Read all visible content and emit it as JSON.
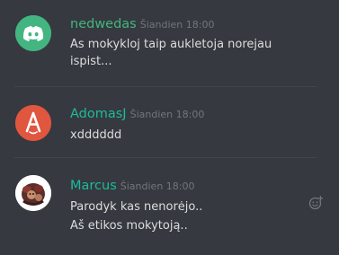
{
  "messages": [
    {
      "username": "nedwedas",
      "username_color": "#43b581",
      "timestamp": "Šiandien 18:00",
      "lines": [
        "As mokykloj taip aukletoja norejau",
        "ispist..."
      ],
      "avatar_icon": "discord-logo-icon",
      "avatar_bg": "#43b581"
    },
    {
      "username": "AdomasJ",
      "username_color": "#1abc9c",
      "timestamp": "Šiandien 18:00",
      "lines": [
        "xdddddd"
      ],
      "avatar_icon": "letter-a-logo-icon",
      "avatar_bg": "#e0563f"
    },
    {
      "username": "Marcus",
      "username_color": "#1abc9c",
      "timestamp": "Šiandien 18:00",
      "lines": [
        "Parodyk kas nenorėjo..",
        "Aš etikos mokytoją.."
      ],
      "avatar_icon": "character-portrait-icon",
      "avatar_bg": "#ffffff"
    }
  ],
  "hover_action_icon": "add-reaction-icon"
}
